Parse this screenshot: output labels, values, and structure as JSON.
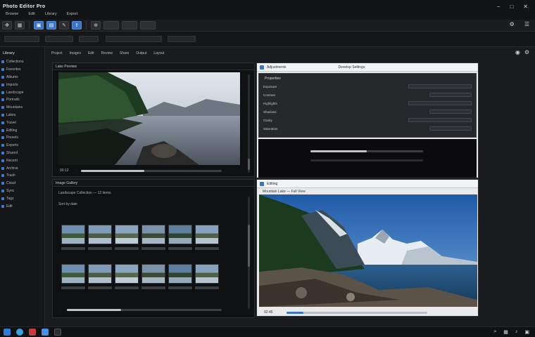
{
  "app": {
    "title": "Photo Editor Pro",
    "menu": [
      "Browse",
      "Edit",
      "Library",
      "Export"
    ]
  },
  "window_controls": {
    "minimize": "−",
    "maximize": "□",
    "close": "✕"
  },
  "toolbar": {
    "buttons": [
      {
        "icon": "move-icon",
        "glyph": "✥",
        "active": false
      },
      {
        "icon": "crop-icon",
        "glyph": "▦",
        "active": false
      },
      {
        "icon": "grid-icon",
        "glyph": "▣",
        "active": true
      },
      {
        "icon": "layers-icon",
        "glyph": "▤",
        "active": true
      },
      {
        "icon": "brush-icon",
        "glyph": "✎",
        "active": false
      },
      {
        "icon": "export-icon",
        "glyph": "⇪",
        "active": true
      },
      {
        "icon": "zoom-icon",
        "glyph": "⊕",
        "active": false
      }
    ],
    "right_icons": [
      "⚙",
      "☰"
    ]
  },
  "sidebar": {
    "header": "Library",
    "items": [
      "Collections",
      "Favorites",
      "Albums",
      "Imports",
      "Landscape",
      "Portraits",
      "Mountains",
      "Lakes",
      "Travel",
      "Editing",
      "Presets",
      "Exports",
      "Shared",
      "Recent",
      "Archive",
      "Trash",
      "Cloud",
      "Sync",
      "Tags",
      "Edit"
    ]
  },
  "workarea": {
    "tabs": [
      "Project",
      "Images",
      "Edit",
      "Review",
      "Share",
      "Output",
      "Layout"
    ]
  },
  "preview_panel": {
    "title": "Lake Preview",
    "time": "00:12",
    "progress": 0.45
  },
  "gallery_panel": {
    "title": "Image Gallery",
    "subtitle": "Landscape Collection — 12 items",
    "filter": "Sort by date",
    "thumbs": 12,
    "progress": 0.35
  },
  "settings_panel": {
    "title": "Adjustments",
    "subtitle": "Develop Settings",
    "dialog_title": "Properties",
    "rows": [
      "Exposure",
      "Contrast",
      "Highlights",
      "Shadows",
      "Clarity",
      "Saturation"
    ],
    "progress": 0.5
  },
  "viewer_panel": {
    "title": "Editing",
    "subtitle": "Mountain Lake — Full View",
    "time": "02:45",
    "progress": 0.12
  },
  "colors": {
    "accent": "#3b74c6",
    "panel_bg": "#0f1012",
    "light_panel": "#e9eaec"
  }
}
